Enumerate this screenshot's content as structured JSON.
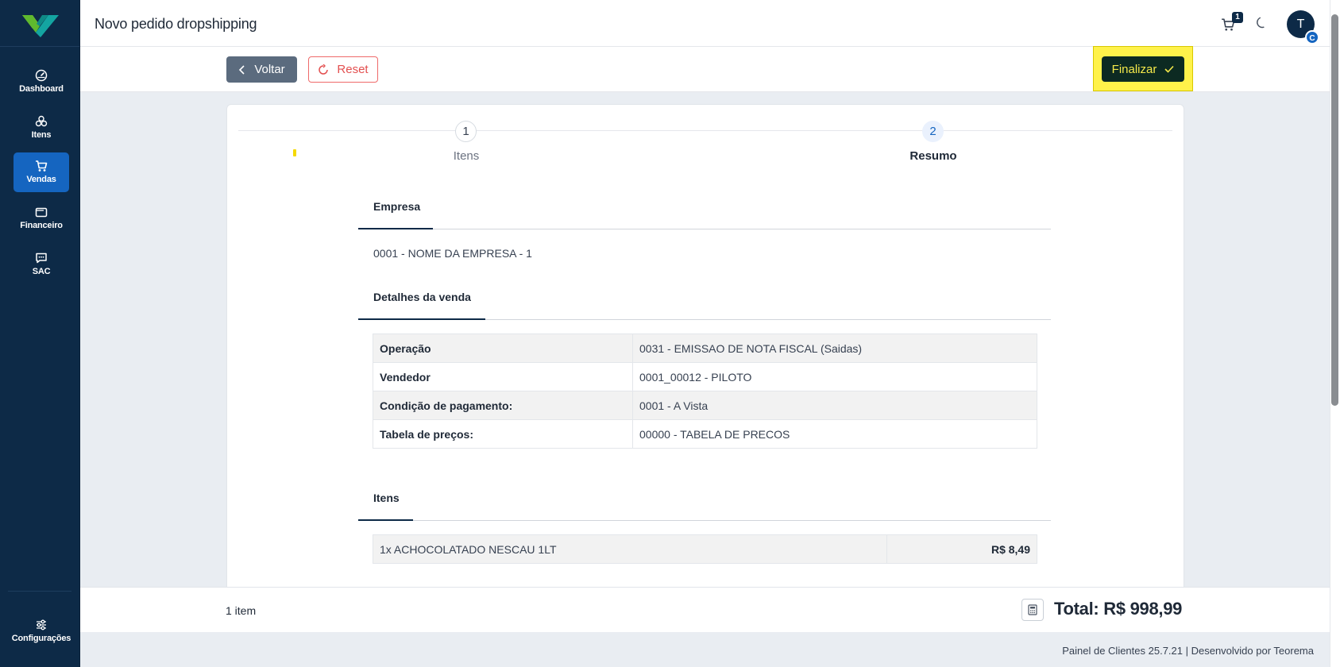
{
  "app": {
    "page_title": "Novo pedido dropshipping"
  },
  "sidebar": {
    "items": [
      {
        "label": "Dashboard",
        "icon": "gauge-icon"
      },
      {
        "label": "Itens",
        "icon": "boxes-icon"
      },
      {
        "label": "Vendas",
        "icon": "cart-icon",
        "active": true
      },
      {
        "label": "Financeiro",
        "icon": "wallet-icon"
      },
      {
        "label": "SAC",
        "icon": "chat-icon"
      }
    ],
    "bottom": {
      "label": "Configurações",
      "icon": "sliders-icon"
    }
  },
  "header": {
    "cart_count": "1",
    "avatar_letter": "T",
    "avatar_sub": "C"
  },
  "toolbar": {
    "back_label": "Voltar",
    "reset_label": "Reset",
    "finish_label": "Finalizar"
  },
  "stepper": {
    "steps": [
      {
        "number": "1",
        "label": "Itens"
      },
      {
        "number": "2",
        "label": "Resumo",
        "active": true
      }
    ]
  },
  "sections": {
    "empresa": {
      "title": "Empresa",
      "value": "0001 - NOME DA EMPRESA - 1"
    },
    "detalhes": {
      "title": "Detalhes da venda",
      "rows": [
        {
          "key": "Operação",
          "value": "0031 - EMISSAO DE NOTA FISCAL (Saidas)"
        },
        {
          "key": "Vendedor",
          "value": "0001_00012 - PILOTO"
        },
        {
          "key": "Condição de pagamento:",
          "value": "0001 - A Vista"
        },
        {
          "key": "Tabela de preços:",
          "value": "00000 - TABELA DE PRECOS"
        }
      ]
    },
    "itens": {
      "title": "Itens",
      "rows": [
        {
          "description": "1x ACHOCOLATADO NESCAU 1LT",
          "price": "R$ 8,49"
        }
      ]
    }
  },
  "summary": {
    "item_count": "1 item",
    "total": "Total: R$ 998,99"
  },
  "footer": {
    "text": "Painel de Clientes  25.7.21  |  Desenvolvido por Teorema"
  },
  "colors": {
    "sidebar": "#0d2a47",
    "active_nav": "#1565c0",
    "finish_btn": "#0c2a22",
    "highlight": "#fff24a",
    "reset": "#e35050"
  }
}
